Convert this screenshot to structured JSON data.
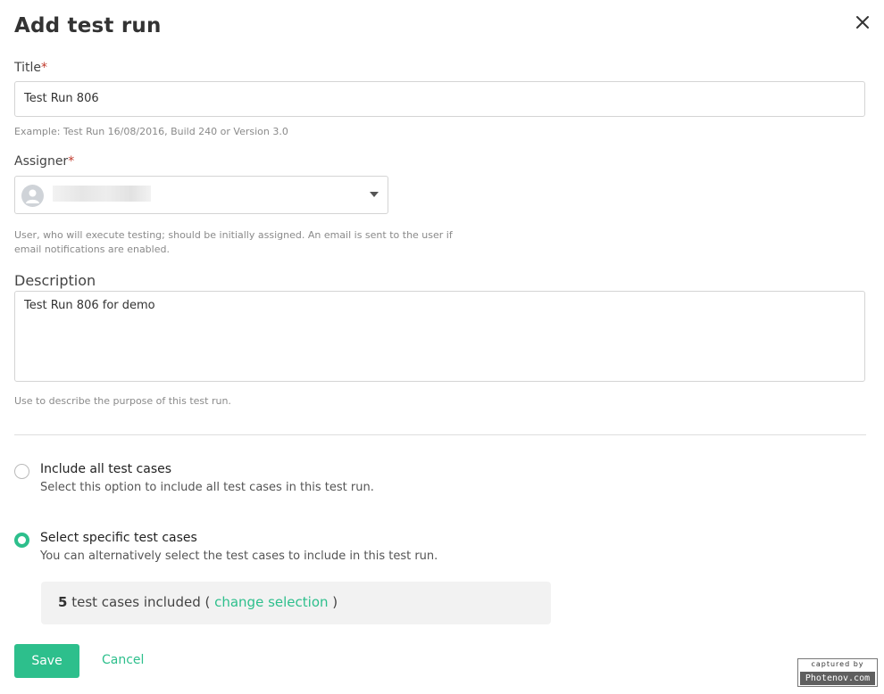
{
  "dialog": {
    "title": "Add test run",
    "close_icon": "close-icon"
  },
  "form": {
    "title_field": {
      "label": "Title",
      "required_mark": "*",
      "value": "Test Run 806",
      "help": "Example: Test Run 16/08/2016, Build 240 or Version 3.0"
    },
    "assigner_field": {
      "label": "Assigner",
      "required_mark": "*",
      "avatar_icon": "user-avatar-icon",
      "dropdown_icon": "caret-down-icon",
      "help": "User, who will execute testing; should be initially assigned. An email is sent to the user if email notifications are enabled."
    },
    "description_field": {
      "label": "Description",
      "value": "Test Run 806 for demo",
      "help": "Use to describe the purpose of this test run."
    }
  },
  "options": [
    {
      "title": "Include all test cases",
      "description": "Select this option to include all test cases in this test run.",
      "selected": false
    },
    {
      "title": "Select specific test cases",
      "description": "You can alternatively select the test cases to include in this test run.",
      "selected": true
    }
  ],
  "selection": {
    "count": "5",
    "text": " test cases included ( ",
    "link": "change selection",
    "close_paren": " )"
  },
  "actions": {
    "save_label": "Save",
    "cancel_label": "Cancel"
  },
  "watermark": {
    "top": "captured by",
    "bottom": "Photenov.com"
  },
  "colors": {
    "accent": "#2dbf8c",
    "required": "#c0392b"
  }
}
